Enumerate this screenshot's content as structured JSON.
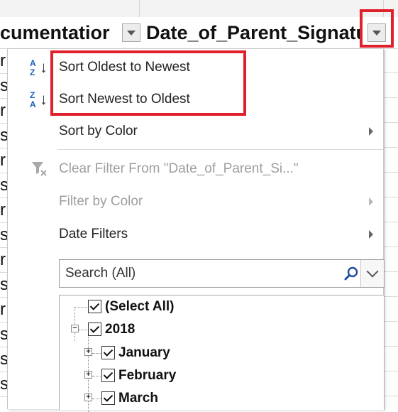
{
  "header": {
    "col_left_fragment": "cumentatior",
    "col_main_title": "Date_of_Parent_Signatur"
  },
  "row_fragments": [
    "r",
    "s",
    "r",
    "s",
    "r",
    "s",
    "r",
    "s",
    "r",
    "s",
    "r",
    "s",
    "s",
    "s"
  ],
  "menu": {
    "sort_asc_label": "Sort Oldest to Newest",
    "sort_desc_label": "Sort Newest to Oldest",
    "sort_by_color_label": "Sort by Color",
    "clear_filter_label": "Clear Filter From \"Date_of_Parent_Si...\"",
    "filter_by_color_label": "Filter by Color",
    "date_filters_label": "Date Filters",
    "sort_asc_icon_top": "A",
    "sort_asc_icon_bottom": "Z",
    "sort_desc_icon_top": "Z",
    "sort_desc_icon_bottom": "A"
  },
  "search": {
    "placeholder": "Search (All)"
  },
  "tree": {
    "select_all": "(Select All)",
    "year": "2018",
    "months": [
      "January",
      "February",
      "March"
    ]
  },
  "colors": {
    "highlight_red": "#e0202c",
    "text_disabled": "#9e9e9e"
  }
}
